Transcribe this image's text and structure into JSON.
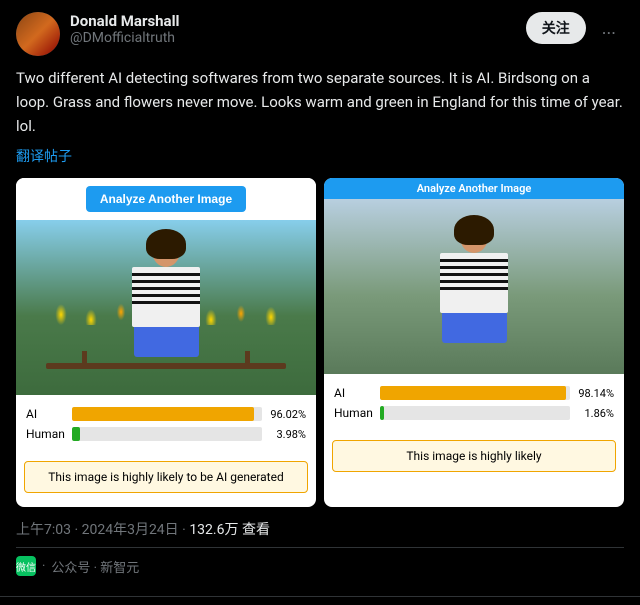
{
  "user": {
    "display_name": "Donald Marshall",
    "username": "@DMofficialtruth",
    "follow_label": "关注",
    "more_label": "..."
  },
  "tweet": {
    "text": "Two different AI detecting softwares from two separate  sources.  It is AI.  Birdsong on a loop. Grass and flowers never move. Looks warm and green in England for this time of year. lol.",
    "translate_label": "翻译帖子",
    "timestamp": "上午7:03 · 2024年3月24日",
    "dot": "·",
    "views_label": "132.6万 查看"
  },
  "card_left": {
    "analyze_btn": "Analyze Another Image",
    "ai_label": "AI",
    "ai_value": "96.02%",
    "ai_percent": 96.02,
    "human_label": "Human",
    "human_value": "3.98%",
    "human_percent": 3.98,
    "result_text": "This image is highly likely to be AI generated"
  },
  "card_right": {
    "analyze_btn_top": "Analyze Another Image",
    "ai_label": "AI",
    "ai_value": "98.14%",
    "ai_percent": 98.14,
    "human_label": "Human",
    "human_value": "1.86%",
    "human_percent": 1.86,
    "result_text": "This image is highly likely"
  },
  "footer": {
    "separator": "·",
    "source_separator": "·",
    "wechat_label": "微信",
    "source_label": "公众号 · 新智元"
  }
}
